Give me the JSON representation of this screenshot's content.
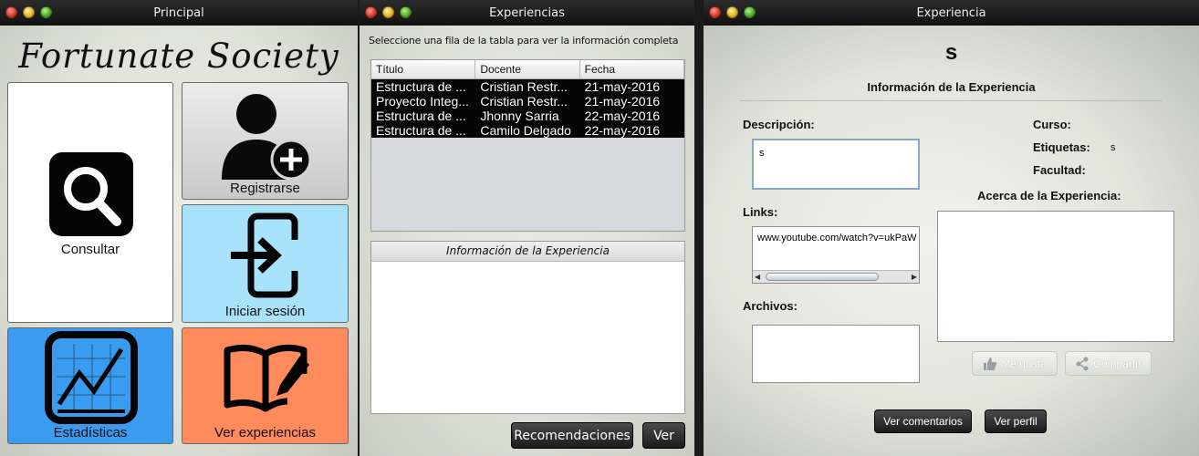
{
  "windows": {
    "principal": {
      "title": "Principal",
      "app_title": "Fortunate Society",
      "tiles": {
        "consultar": {
          "label": "Consultar",
          "color": "#ffffff",
          "icon": "search-icon"
        },
        "registrarse": {
          "label": "Registrarse",
          "color": "#d9d9d9",
          "icon": "add-user-icon"
        },
        "iniciar_sesion": {
          "label": "Iniciar sesión",
          "color": "#a8e2fb",
          "icon": "login-icon"
        },
        "estadisticas": {
          "label": "Estadísticas",
          "color": "#3a9cf0",
          "icon": "chart-icon"
        },
        "ver_experiencias": {
          "label": "Ver experiencias",
          "color": "#ff8a5c",
          "icon": "book-edit-icon"
        }
      }
    },
    "experiencias": {
      "title": "Experiencias",
      "hint": "Seleccione una fila de la tabla para ver la información completa",
      "table": {
        "columns": [
          "Título",
          "Docente",
          "Fecha"
        ],
        "rows": [
          [
            "Estructura de ...",
            "Cristian Restr...",
            "21-may-2016"
          ],
          [
            "Proyecto Integ...",
            "Cristian Restr...",
            "21-may-2016"
          ],
          [
            "Estructura de ...",
            "Jhonny Sarria",
            "22-may-2016"
          ],
          [
            "Estructura de ...",
            "Camilo Delgado",
            "22-may-2016"
          ]
        ]
      },
      "info_header": "Información de la Experiencia",
      "buttons": {
        "recomendaciones": "Recomendaciones",
        "ver": "Ver"
      }
    },
    "experiencia": {
      "title": "Experiencia",
      "name": "s",
      "section_title": "Información de la Experiencia",
      "labels": {
        "descripcion": "Descripción:",
        "links": "Links:",
        "archivos": "Archivos:",
        "curso": "Curso:",
        "etiquetas": "Etiquetas:",
        "facultad": "Facultad:",
        "acerca": "Acerca de la Experiencia:"
      },
      "values": {
        "descripcion": "s",
        "link": "www.youtube.com/watch?v=ukPaW",
        "etiquetas": "s"
      },
      "buttons": {
        "me_gusta": "Me gusta",
        "compartir": "Compartir",
        "ver_comentarios": "Ver comentarios",
        "ver_perfil": "Ver perfil"
      }
    }
  }
}
